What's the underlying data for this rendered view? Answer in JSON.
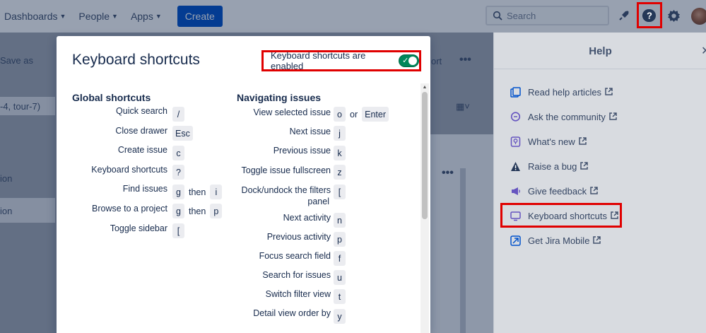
{
  "topnav": {
    "dashboards": "Dashboards",
    "people": "People",
    "apps": "Apps",
    "create": "Create",
    "search_placeholder": "Search"
  },
  "background": {
    "save_as": "Save as",
    "filter_text": "-4, tour-7)",
    "export_fragment": "ort",
    "row1": "ion",
    "row2": "ion"
  },
  "help": {
    "title": "Help",
    "items": [
      {
        "label": "Read help articles",
        "icon": "document-icon"
      },
      {
        "label": "Ask the community",
        "icon": "chat-icon"
      },
      {
        "label": "What's new",
        "icon": "lightbulb-icon"
      },
      {
        "label": "Raise a bug",
        "icon": "warning-icon"
      },
      {
        "label": "Give feedback",
        "icon": "megaphone-icon"
      },
      {
        "label": "Keyboard shortcuts",
        "icon": "keyboard-icon"
      },
      {
        "label": "Get Jira Mobile",
        "icon": "send-icon"
      }
    ]
  },
  "modal": {
    "title": "Keyboard shortcuts",
    "toggle_label": "Keyboard shortcuts are enabled",
    "global": {
      "title": "Global shortcuts",
      "rows": [
        {
          "label": "Quick search",
          "keys": [
            "/"
          ]
        },
        {
          "label": "Close drawer",
          "keys": [
            "Esc"
          ]
        },
        {
          "label": "Create issue",
          "keys": [
            "c"
          ]
        },
        {
          "label": "Keyboard shortcuts",
          "keys": [
            "?"
          ]
        },
        {
          "label": "Find issues",
          "keys": [
            "g",
            "then",
            "i"
          ]
        },
        {
          "label": "Browse to a project",
          "keys": [
            "g",
            "then",
            "p"
          ]
        },
        {
          "label": "Toggle sidebar",
          "keys": [
            "["
          ]
        }
      ]
    },
    "navigating": {
      "title": "Navigating issues",
      "rows": [
        {
          "label": "View selected issue",
          "keys": [
            "o",
            "or",
            "Enter"
          ]
        },
        {
          "label": "Next issue",
          "keys": [
            "j"
          ]
        },
        {
          "label": "Previous issue",
          "keys": [
            "k"
          ]
        },
        {
          "label": "Toggle issue fullscreen",
          "keys": [
            "z"
          ]
        },
        {
          "label": "Dock/undock the filters",
          "label2": "panel",
          "keys": [
            "["
          ]
        },
        {
          "label": "Next activity",
          "keys": [
            "n"
          ]
        },
        {
          "label": "Previous activity",
          "keys": [
            "p"
          ]
        },
        {
          "label": "Focus search field",
          "keys": [
            "f"
          ]
        },
        {
          "label": "Search for issues",
          "keys": [
            "u"
          ]
        },
        {
          "label": "Switch filter view",
          "keys": [
            "t"
          ]
        },
        {
          "label": "Detail view order by",
          "keys": [
            "y"
          ]
        }
      ]
    }
  },
  "colors": {
    "primary": "#0052cc",
    "toggle_on": "#00875a",
    "highlight": "#e00000"
  }
}
